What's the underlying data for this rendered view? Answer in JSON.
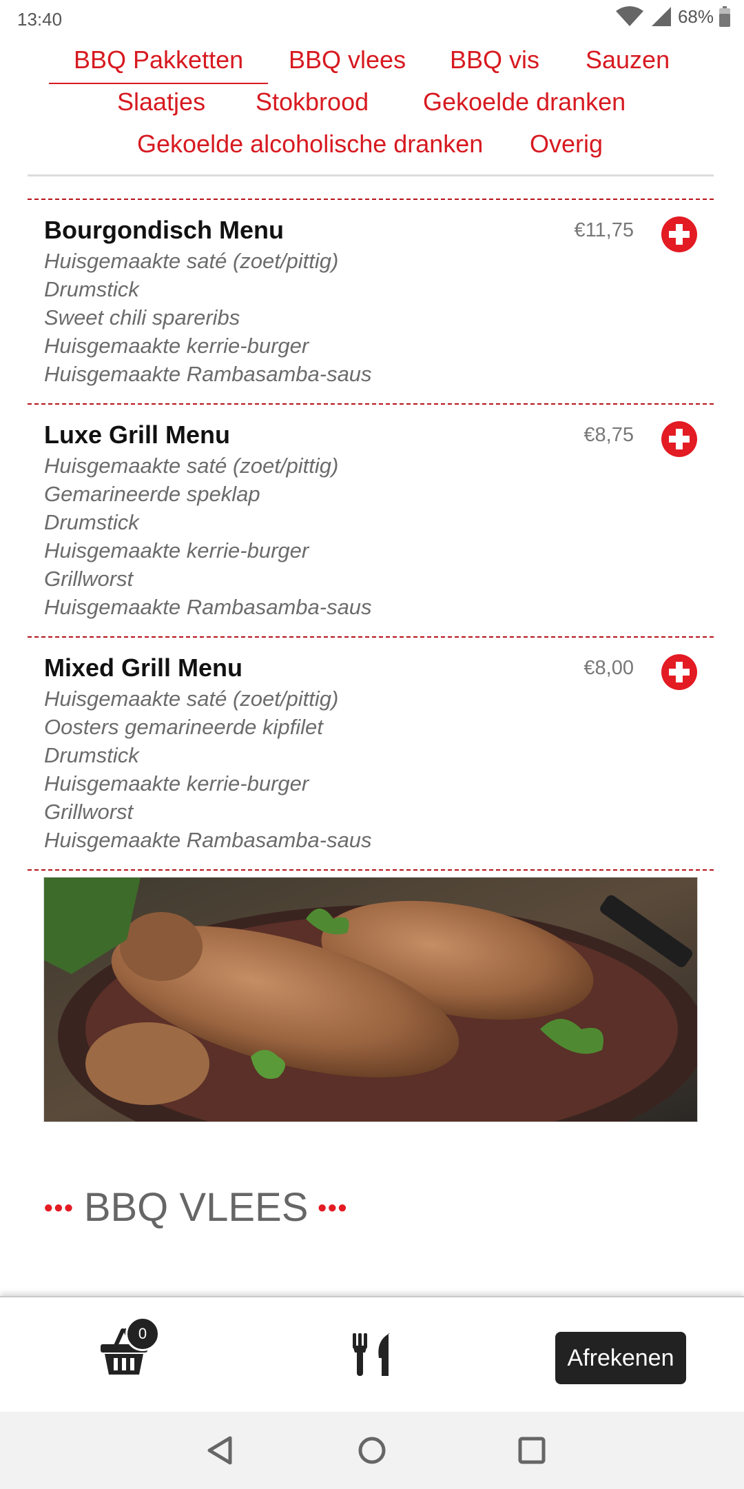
{
  "status_bar": {
    "time": "13:40",
    "battery": "68%"
  },
  "tabs": [
    {
      "label": "BBQ Pakketten",
      "active": true
    },
    {
      "label": "BBQ vlees"
    },
    {
      "label": "BBQ vis"
    },
    {
      "label": "Sauzen"
    },
    {
      "label": "Slaatjes"
    },
    {
      "label": "Stokbrood"
    },
    {
      "label": "Gekoelde dranken"
    },
    {
      "label": "Gekoelde alcoholische dranken"
    },
    {
      "label": "Overig"
    }
  ],
  "menu_items": [
    {
      "name": "Bourgondisch Menu",
      "price": "€11,75",
      "lines": [
        "Huisgemaakte saté (zoet/pittig)",
        "Drumstick",
        "Sweet chili spareribs",
        "Huisgemaakte kerrie-burger",
        "Huisgemaakte Rambasamba-saus"
      ]
    },
    {
      "name": "Luxe Grill Menu",
      "price": "€8,75",
      "lines": [
        "Huisgemaakte saté (zoet/pittig)",
        "Gemarineerde speklap",
        "Drumstick",
        "Huisgemaakte kerrie-burger",
        "Grillworst",
        "Huisgemaakte Rambasamba-saus"
      ]
    },
    {
      "name": "Mixed Grill Menu",
      "price": "€8,00",
      "lines": [
        "Huisgemaakte saté (zoet/pittig)",
        "Oosters gemarineerde kipfilet",
        "Drumstick",
        "Huisgemaakte kerrie-burger",
        "Grillworst",
        "Huisgemaakte Rambasamba-saus"
      ]
    }
  ],
  "section": {
    "title": "BBQ VLEES",
    "dots": "•••"
  },
  "bottom_bar": {
    "cart_count": "0",
    "checkout_label": "Afrekenen"
  },
  "icons": {
    "add": "plus-circle-icon",
    "cart": "basket-icon",
    "menu": "fork-knife-icon"
  },
  "colors": {
    "accent": "#e31b23",
    "tab_text": "#d71920",
    "dark_button": "#222222"
  }
}
